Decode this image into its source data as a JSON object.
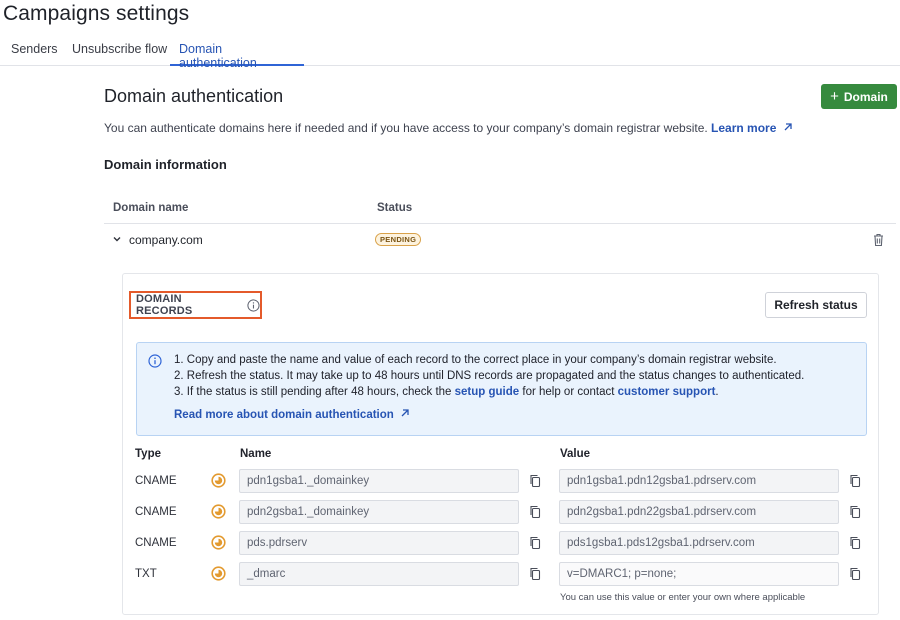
{
  "page": {
    "title": "Campaigns settings"
  },
  "tabs": [
    {
      "label": "Senders",
      "active": false
    },
    {
      "label": "Unsubscribe flow",
      "active": false
    },
    {
      "label": "Domain authentication",
      "active": true
    }
  ],
  "domain_auth": {
    "title": "Domain authentication",
    "add_button_label": "Domain",
    "intro_text": "You can authenticate domains here if needed and if you have access to your company’s domain registrar website.",
    "learn_more_label": "Learn more",
    "domain_info_title": "Domain information",
    "columns": {
      "domain_name": "Domain name",
      "status": "Status"
    },
    "domains": [
      {
        "name": "company.com",
        "status": "PENDING"
      }
    ]
  },
  "records": {
    "title": "DOMAIN RECORDS",
    "refresh_label": "Refresh status",
    "instructions": {
      "line1": "1. Copy and paste the name and value of each record to the correct place in your company’s domain registrar website.",
      "line2": "2. Refresh the status. It may take up to 48 hours until DNS records are propagated and the status changes to authenticated.",
      "line3_prefix": "3. If the status is still pending after 48 hours, check the",
      "setup_guide_label": "setup guide",
      "line3_middle": "for help or contact",
      "support_label": "customer support",
      "line3_suffix": ".",
      "read_more_label": "Read more about domain authentication"
    },
    "columns": {
      "type": "Type",
      "name": "Name",
      "value": "Value"
    },
    "rows": [
      {
        "type": "CNAME",
        "name": "pdn1gsba1._domainkey",
        "value": "pdn1gsba1.pdn12gsba1.pdrserv.com"
      },
      {
        "type": "CNAME",
        "name": "pdn2gsba1._domainkey",
        "value": "pdn2gsba1.pdn22gsba1.pdrserv.com"
      },
      {
        "type": "CNAME",
        "name": "pds.pdrserv",
        "value": "pds1gsba1.pds12gsba1.pdrserv.com"
      },
      {
        "type": "TXT",
        "name": "_dmarc",
        "value": "v=DMARC1; p=none;"
      }
    ],
    "value_hint": "You can use this value or enter your own where applicable"
  },
  "colors": {
    "primary_green": "#368a3e",
    "link_blue": "#2754b3",
    "pending_orange": "#e39a2f",
    "highlight_red": "#e45a2b"
  },
  "icons": {
    "record_status": "pending-clock-icon",
    "copy": "copy-icon",
    "delete": "trash-icon",
    "expand": "chevron-down-icon",
    "info": "info-icon",
    "external": "external-link-icon"
  }
}
